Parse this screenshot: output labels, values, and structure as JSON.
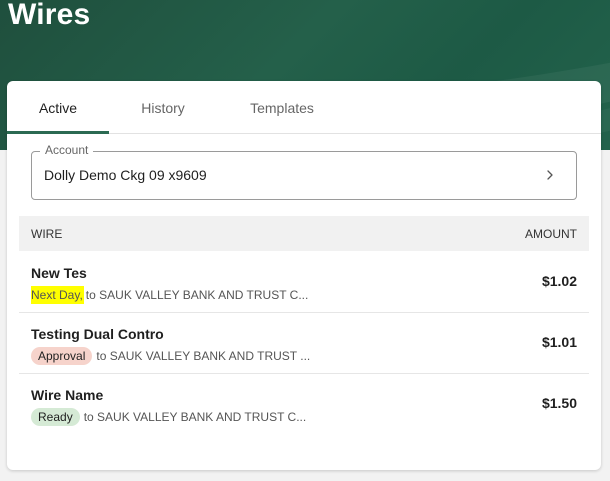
{
  "page": {
    "title": "Wires"
  },
  "tabs": [
    {
      "label": "Active",
      "active": true
    },
    {
      "label": "History",
      "active": false
    },
    {
      "label": "Templates",
      "active": false
    }
  ],
  "account": {
    "label": "Account",
    "value": "Dolly Demo Ckg 09 x9609"
  },
  "table": {
    "headers": {
      "wire": "WIRE",
      "amount": "AMOUNT"
    },
    "rows": [
      {
        "name": "New Tes",
        "status": "Next Day,",
        "status_type": "plain",
        "destination": "to SAUK VALLEY BANK AND TRUST C...",
        "amount": "$1.02"
      },
      {
        "name": "Testing Dual Contro",
        "status": "Approval",
        "status_type": "approval",
        "destination": "to SAUK VALLEY BANK AND TRUST ...",
        "amount": "$1.01"
      },
      {
        "name": "Wire Name",
        "status": "Ready",
        "status_type": "ready",
        "destination": "to SAUK VALLEY BANK AND TRUST C...",
        "amount": "$1.50"
      }
    ]
  },
  "icons": {
    "account_chevron": "chevron-right-icon"
  },
  "colors": {
    "header_green": "#24604a",
    "tab_indicator": "#2b6a52",
    "approval_badge": "#f6d3cb",
    "ready_badge": "#d5ead5",
    "highlight": "#ffff00"
  }
}
